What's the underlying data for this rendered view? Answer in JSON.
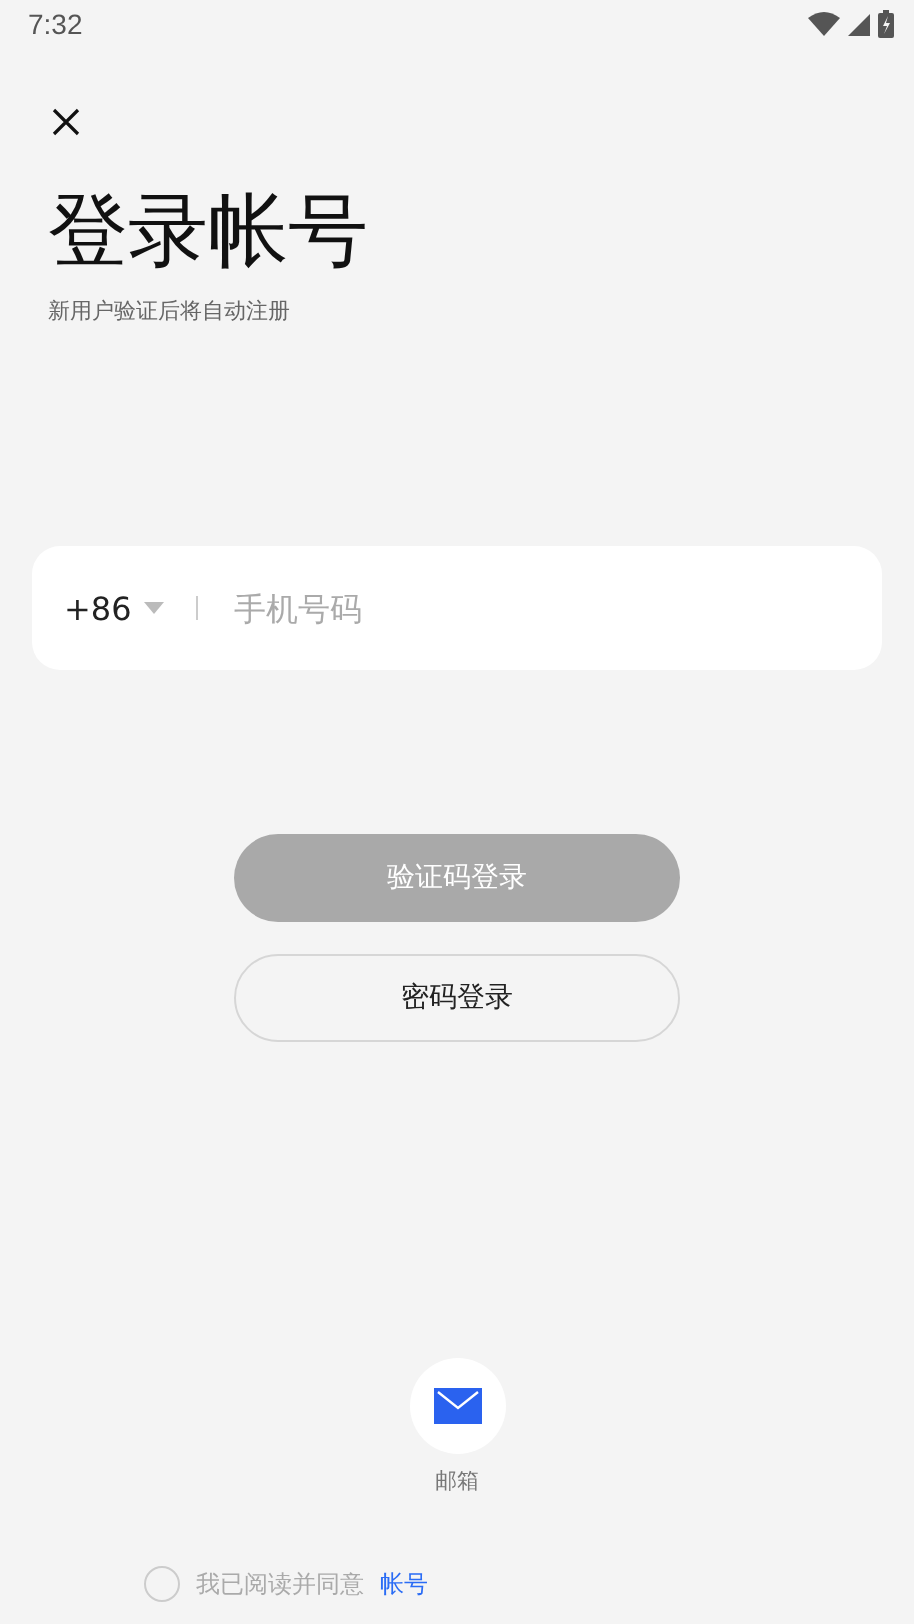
{
  "status_bar": {
    "time": "7:32"
  },
  "title": "登录帐号",
  "subtitle": "新用户验证后将自动注册",
  "phone": {
    "country_code": "+86",
    "placeholder": "手机号码"
  },
  "buttons": [
    {
      "label": "验证码登录",
      "kind": "filled",
      "disabled": true
    },
    {
      "label": "密码登录",
      "kind": "outline",
      "disabled": false
    }
  ],
  "other_logins": [
    {
      "label": "邮箱",
      "kind": "email"
    }
  ],
  "agreement": {
    "checked": false,
    "text": "我已阅读并同意",
    "link": "帐号"
  }
}
